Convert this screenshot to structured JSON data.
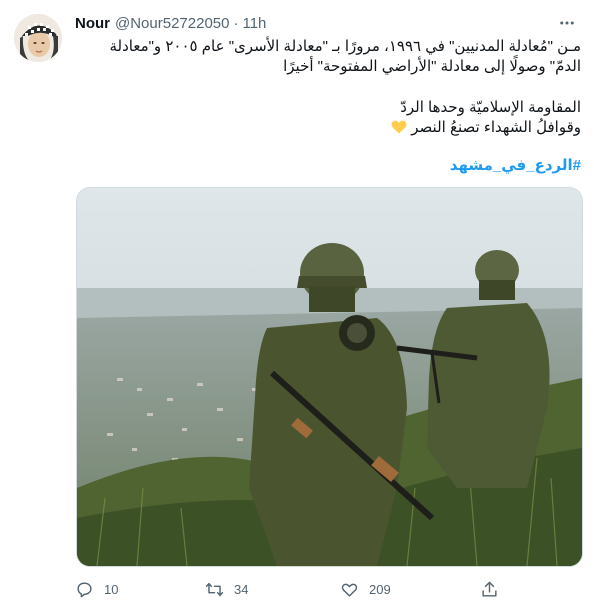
{
  "tweet": {
    "author_name": "Nour",
    "author_handle": "@Nour52722050",
    "separator": "·",
    "time": "11h",
    "lines": [
      "مـن \"مُعادلة المدنيين\" في ١٩٩٦، مرورًا بـ \"معادلة الأسرى\" عام ٢٠٠٥ و\"معادلة",
      "الدمّ\" وصولًا إلى معادلة \"الأراضي المفتوحة\" أخيرًا",
      "المقاومة الإسلاميّة وحدها الردّ",
      "وقوافلُ الشهداء تصنعُ النصر"
    ],
    "hashtag": "#الردع_في_مشهد",
    "emoji_icon": "yellow-heart-icon",
    "accent_color": "#1d9bf0"
  },
  "actions": {
    "replies": "10",
    "retweets": "34",
    "likes": "209",
    "icons": [
      "reply-icon",
      "retweet-icon",
      "like-icon",
      "share-icon"
    ]
  }
}
